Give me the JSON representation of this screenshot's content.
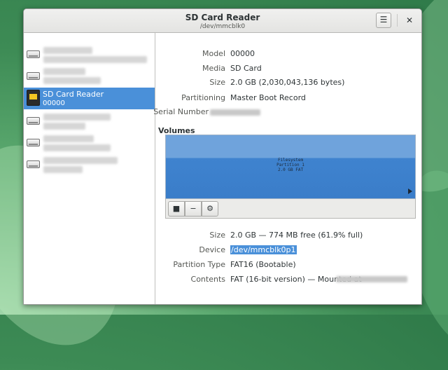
{
  "window": {
    "title": "SD Card Reader",
    "subtitle": "/dev/mmcblk0",
    "menu_icon": "hamburger-menu-icon",
    "close_icon": "close-icon"
  },
  "sidebar": {
    "items": [
      {
        "name": "",
        "sub": "",
        "icon": "disk-icon",
        "selected": false
      },
      {
        "name": "",
        "sub": "",
        "icon": "disk-icon",
        "selected": false
      },
      {
        "name": "SD Card Reader",
        "sub": "00000",
        "icon": "sd-card-icon",
        "selected": true
      },
      {
        "name": "",
        "sub": "",
        "icon": "disk-icon",
        "selected": false
      },
      {
        "name": "",
        "sub": "",
        "icon": "disk-icon",
        "selected": false
      },
      {
        "name": "",
        "sub": "",
        "icon": "disk-icon",
        "selected": false
      }
    ]
  },
  "device": {
    "model_label": "Model",
    "model": "00000",
    "media_label": "Media",
    "media": "SD Card",
    "size_label": "Size",
    "size": "2.0 GB (2,030,043,136 bytes)",
    "partitioning_label": "Partitioning",
    "partitioning": "Master Boot Record",
    "serial_label": "Serial Number",
    "serial": ""
  },
  "volumes": {
    "heading": "Volumes",
    "partition": {
      "line1": "Filesystem",
      "line2": "Partition 1",
      "line3": "2.0 GB FAT"
    },
    "colors": {
      "header": "#6fa3dc",
      "body": "#3f83cf",
      "selection": "#4a90d9"
    },
    "toolbar": {
      "stop_icon": "stop-icon",
      "minus_icon": "minus-icon",
      "gear_icon": "gear-icon"
    }
  },
  "partition_details": {
    "size_label": "Size",
    "size": "2.0 GB — 774 MB free (61.9% full)",
    "device_label": "Device",
    "device": "/dev/mmcblk0p1",
    "type_label": "Partition Type",
    "type": "FAT16 (Bootable)",
    "contents_label": "Contents",
    "contents": "FAT (16-bit version) — Mounted at"
  }
}
